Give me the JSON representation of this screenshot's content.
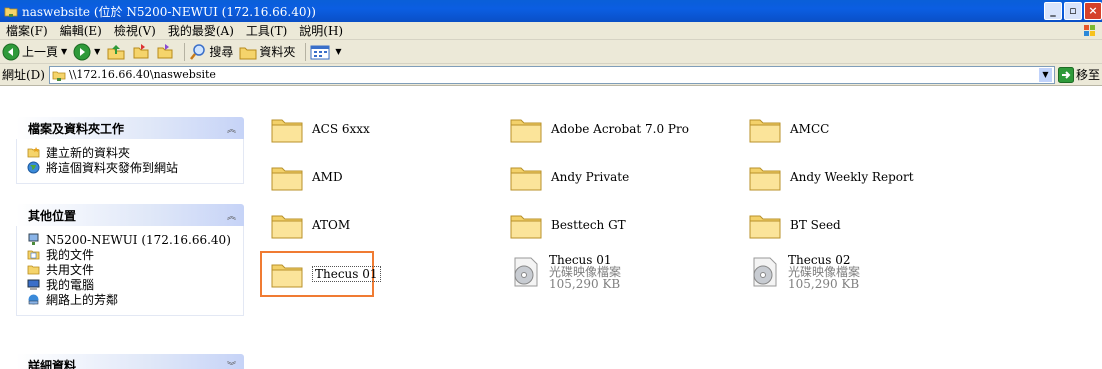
{
  "window": {
    "title": "naswebsite (位於 N5200-NEWUI (172.16.66.40))"
  },
  "menu": [
    "檔案(F)",
    "編輯(E)",
    "檢視(V)",
    "我的最愛(A)",
    "工具(T)",
    "說明(H)"
  ],
  "toolbar": {
    "back": "上一頁",
    "search": "搜尋",
    "folders": "資料夾"
  },
  "address": {
    "label": "網址(D)",
    "value": "\\\\172.16.66.40\\naswebsite",
    "go": "移至"
  },
  "tasks": {
    "file_tasks": {
      "title": "檔案及資料夾工作",
      "items": [
        "建立新的資料夾",
        "將這個資料夾發佈到網站"
      ]
    },
    "other_places": {
      "title": "其他位置",
      "items": [
        "N5200-NEWUI (172.16.66.40)",
        "我的文件",
        "共用文件",
        "我的電腦",
        "網路上的芳鄰"
      ]
    },
    "details": {
      "title": "詳細資料"
    }
  },
  "files": [
    {
      "name": "ACS 6xxx",
      "type": "folder"
    },
    {
      "name": "Adobe Acrobat 7.0 Pro",
      "type": "folder"
    },
    {
      "name": "AMCC",
      "type": "folder"
    },
    {
      "name": "AMD",
      "type": "folder"
    },
    {
      "name": "Andy Private",
      "type": "folder"
    },
    {
      "name": "Andy Weekly Report",
      "type": "folder"
    },
    {
      "name": "ATOM",
      "type": "folder"
    },
    {
      "name": "Besttech GT",
      "type": "folder"
    },
    {
      "name": "BT Seed",
      "type": "folder"
    },
    {
      "name": "Thecus 01",
      "type": "folder",
      "selected": true
    },
    {
      "name": "Thecus 01",
      "type": "disc-image",
      "kind": "光碟映像檔案",
      "size": "105,290 KB"
    },
    {
      "name": "Thecus 02",
      "type": "disc-image",
      "kind": "光碟映像檔案",
      "size": "105,290 KB"
    }
  ],
  "colors": {
    "titlebar": "#0a5fd8",
    "selection_outline": "#f07b32",
    "chrome": "#ece9d8"
  }
}
